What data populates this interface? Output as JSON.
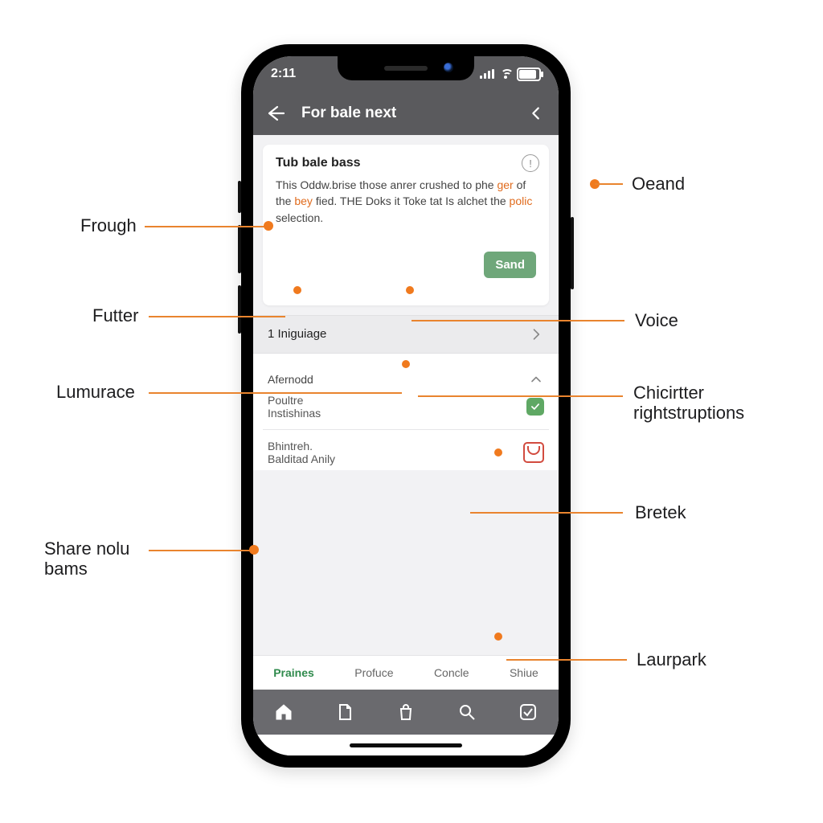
{
  "statusbar": {
    "time": "2:11"
  },
  "header": {
    "title": "For bale next"
  },
  "card": {
    "title": "Tub bale bass",
    "body_part1": "This Oddw.brise those anrer crushed to phe ",
    "body_accent1": "ger",
    "body_part2": " of the ",
    "body_accent2": "bey",
    "body_part3": " fied. THE Doks it Toke tat Is alchet the ",
    "body_accent3": "polic",
    "body_part4": " selection.",
    "send_label": "Sand",
    "info_symbol": "!"
  },
  "language_row": {
    "label": "1 Iniguiage"
  },
  "sublist": {
    "header": "Afernodd",
    "item1_line1": "Poultre",
    "item1_line2": "Instishinas",
    "item2_line1": "Bhintreh.",
    "item2_line2": "Balditad Anily"
  },
  "tabs": {
    "t1": "Praines",
    "t2": "Profuce",
    "t3": "Concle",
    "t4": "Shiue"
  },
  "callouts": {
    "frough": "Frough",
    "futter": "Futter",
    "lumurace": "Lumurace",
    "share": "Share nolu\nbams",
    "oeand": "Oeand",
    "voice": "Voice",
    "chic": "Chicirtter\nrightstruptions",
    "bretek": "Bretek",
    "laurpark": "Laurpark"
  }
}
